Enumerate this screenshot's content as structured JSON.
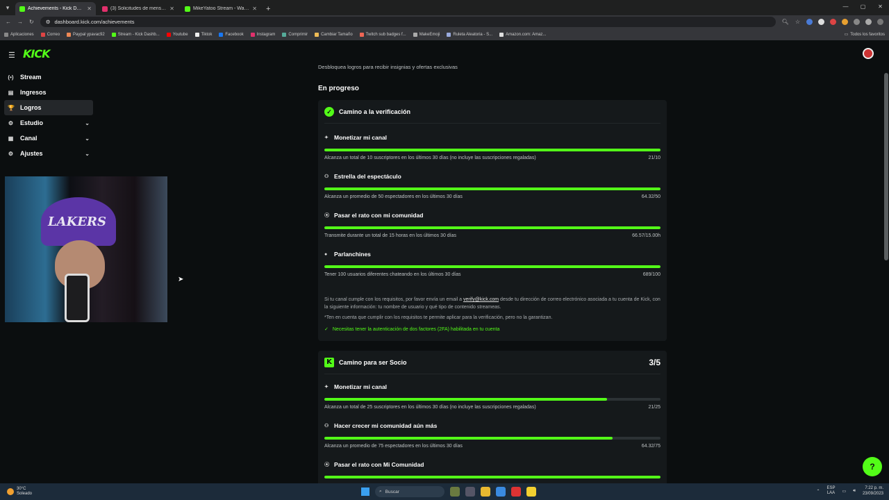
{
  "browser": {
    "tabs": [
      {
        "title": "Achievements - Kick Dashboard",
        "color": "#53fc18",
        "active": true
      },
      {
        "title": "(3) Solicitudes de mensajes • Ch",
        "color": "#e1306c",
        "active": false
      },
      {
        "title": "MikeYatoo Stream - Watch Live",
        "color": "#53fc18",
        "active": false
      }
    ],
    "url": "dashboard.kick.com/achievements",
    "bookmarks": [
      {
        "label": "Aplicaciones",
        "color": "#888"
      },
      {
        "label": "Correo",
        "color": "#d44"
      },
      {
        "label": "Paypal ypavac92",
        "color": "#e85"
      },
      {
        "label": "Stream - Kick Dashb...",
        "color": "#53fc18"
      },
      {
        "label": "Youtube",
        "color": "#f00"
      },
      {
        "label": "Tiktok",
        "color": "#eee"
      },
      {
        "label": "Facebook",
        "color": "#1877f2"
      },
      {
        "label": "Instagram",
        "color": "#e1306c"
      },
      {
        "label": "Comprimir",
        "color": "#5a9"
      },
      {
        "label": "Cambiar Tamaño",
        "color": "#eb5"
      },
      {
        "label": "Twitch sub badges f...",
        "color": "#e65"
      },
      {
        "label": "MakeEmoji",
        "color": "#aaa"
      },
      {
        "label": "Ruleta Aleatoria - S...",
        "color": "#9ad"
      },
      {
        "label": "Amazon.com: Amaz...",
        "color": "#ddd"
      }
    ],
    "bookmarks_right": "Todos los favoritos"
  },
  "app": {
    "logo": "KICK",
    "sidebar": {
      "items": [
        {
          "label": "Stream",
          "icon": "(•)",
          "expandable": false,
          "active": false
        },
        {
          "label": "Ingresos",
          "icon": "▤",
          "expandable": false,
          "active": false
        },
        {
          "label": "Logros",
          "icon": "🏆",
          "expandable": false,
          "active": true
        },
        {
          "label": "Estudio",
          "icon": "⚙",
          "expandable": true,
          "active": false
        },
        {
          "label": "Canal",
          "icon": "▦",
          "expandable": true,
          "active": false
        },
        {
          "label": "Ajustes",
          "icon": "⚙",
          "expandable": true,
          "active": false
        }
      ]
    },
    "main": {
      "subtitle": "Desbloquea logros para recibir insignias y ofertas exclusivas",
      "section_title": "En progreso",
      "card1": {
        "title": "Camino a la verificación",
        "achievements": [
          {
            "title": "Monetizar mi canal",
            "desc": "Alcanza un total de 10 suscriptores en los últimos 30 días (no incluye las suscripciones regaladas)",
            "value": "21/10",
            "progress": 1.0
          },
          {
            "title": "Estrella del espectáculo",
            "desc": "Alcanza un promedio de 50 espectadores en los últimos 30 días",
            "value": "64.32/50",
            "progress": 1.0
          },
          {
            "title": "Pasar el rato con mi comunidad",
            "desc": "Transmite durante un total de 15 horas en los últimos 30 días",
            "value": "66.57/15.00h",
            "progress": 1.0
          },
          {
            "title": "Parlanchines",
            "desc": "Tener 100 usuarios diferentes chateando en los últimos 30 días",
            "value": "689/100",
            "progress": 1.0
          }
        ],
        "info_pre": "Si tu canal cumple con los requisitos, por favor envía un email a ",
        "info_link": "verify@kick.com",
        "info_post": " desde tu dirección de correo electrónico asociada a tu cuenta de Kick, con la siguiente información: tu nombre de usuario y qué tipo de contenido streameas.",
        "info_note": "*Ten en cuenta que cumplir con los requisitos te permite aplicar para la verificación, pero no la garantizan.",
        "info_ok": "Necesitas tener la autenticación de dos factores (2FA) habilitada en tu cuenta"
      },
      "card2": {
        "title": "Camino para ser Socio",
        "count": "3/5",
        "achievements": [
          {
            "title": "Monetizar mi canal",
            "desc": "Alcanza un total de 25 suscriptores en los últimos 30 días (no incluye las suscripciones regaladas)",
            "value": "21/25",
            "progress": 0.84
          },
          {
            "title": "Hacer crecer mi comunidad aún más",
            "desc": "Alcanza un promedio de 75 espectadores en los últimos 30 días",
            "value": "64.32/75",
            "progress": 0.858
          },
          {
            "title": "Pasar el rato con Mi Comunidad",
            "desc": "",
            "value": "",
            "progress": 1.0
          }
        ]
      }
    },
    "accent": "#53fc18"
  },
  "webcam": {
    "cap_text": "LAKERS"
  },
  "taskbar": {
    "weather_temp": "30°C",
    "weather_desc": "Soleado",
    "search_placeholder": "Buscar",
    "lang_top": "ESP",
    "lang_bottom": "LAA",
    "time": "7:22 p. m.",
    "date": "23/09/2023"
  }
}
